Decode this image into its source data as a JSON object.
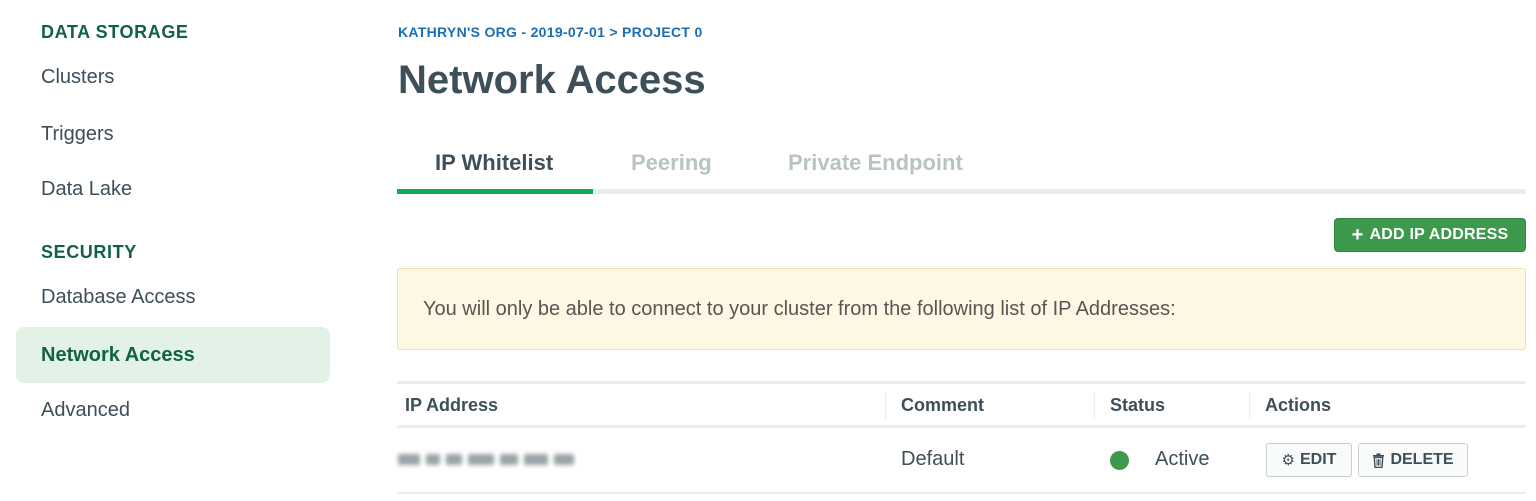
{
  "sidebar": {
    "sections": [
      {
        "heading": "DATA STORAGE",
        "items": [
          {
            "label": "Clusters"
          },
          {
            "label": "Triggers"
          },
          {
            "label": "Data Lake"
          }
        ]
      },
      {
        "heading": "SECURITY",
        "items": [
          {
            "label": "Database Access"
          },
          {
            "label": "Network Access",
            "active": true
          },
          {
            "label": "Advanced"
          }
        ]
      }
    ]
  },
  "breadcrumb": "KATHRYN'S ORG - 2019-07-01 > PROJECT 0",
  "page_title": "Network Access",
  "tabs": [
    {
      "label": "IP Whitelist",
      "active": true
    },
    {
      "label": "Peering",
      "active": false
    },
    {
      "label": "Private Endpoint",
      "active": false
    }
  ],
  "add_button": {
    "icon": "plus-icon",
    "label": "ADD IP ADDRESS"
  },
  "notice": "You will only be able to connect to your cluster from the following list of IP Addresses:",
  "table": {
    "columns": [
      "IP Address",
      "Comment",
      "Status",
      "Actions"
    ],
    "rows": [
      {
        "ip_address": "",
        "comment": "Default",
        "status": "Active",
        "actions": [
          {
            "icon": "gear-icon",
            "label": "EDIT"
          },
          {
            "icon": "trash-icon",
            "label": "DELETE"
          }
        ]
      }
    ]
  },
  "colors": {
    "accent_green": "#13aa52",
    "button_green": "#3d9a4c",
    "section_heading": "#116149",
    "breadcrumb_blue": "#1a6fb4",
    "active_nav_bg": "#e3f2e6",
    "notice_bg": "#fef7e3",
    "notice_border": "#f3dfab"
  }
}
